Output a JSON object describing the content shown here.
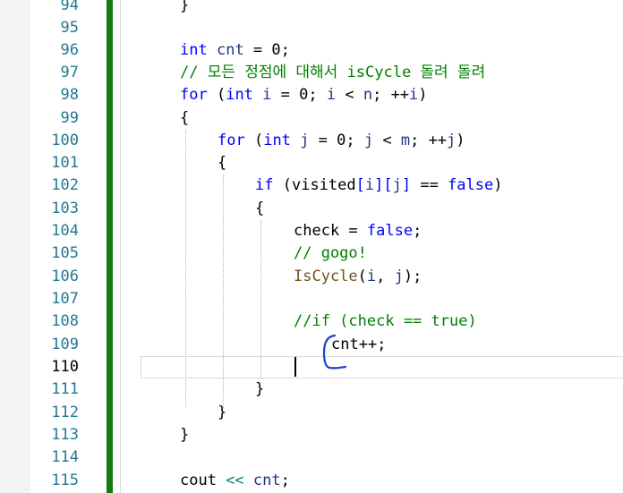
{
  "line_numbers": [
    "94",
    "95",
    "96",
    "97",
    "98",
    "99",
    "100",
    "101",
    "102",
    "103",
    "104",
    "105",
    "106",
    "107",
    "108",
    "109",
    "110",
    "111",
    "112",
    "113",
    "114",
    "115"
  ],
  "current_line": "110",
  "code": {
    "l94_brace": "}",
    "l96_int": "int",
    "l96_cnt": "cnt",
    "l96_eq": " = ",
    "l96_zero": "0",
    "l96_semi": ";",
    "l97_comment": "// 모든 정점에 대해서 isCycle 돌려 돌려",
    "l98_for": "for",
    "l98_open": " (",
    "l98_int": "int",
    "l98_i1": " i",
    "l98_eq": " = ",
    "l98_zero": "0",
    "l98_semi1": "; ",
    "l98_i2": "i",
    "l98_lt": " < ",
    "l98_n": "n",
    "l98_semi2": "; ",
    "l98_inc": "++",
    "l98_i3": "i",
    "l98_close": ")",
    "l99_brace": "{",
    "l100_for": "for",
    "l100_open": " (",
    "l100_int": "int",
    "l100_j1": " j",
    "l100_eq": " = ",
    "l100_zero": "0",
    "l100_semi1": "; ",
    "l100_j2": "j",
    "l100_lt": " < ",
    "l100_m": "m",
    "l100_semi2": "; ",
    "l100_inc": "++",
    "l100_j3": "j",
    "l100_close": ")",
    "l101_brace": "{",
    "l102_if": "if",
    "l102_open": " (",
    "l102_visited": "visited",
    "l102_b1": "[",
    "l102_i": "i",
    "l102_b2": "][",
    "l102_j": "j",
    "l102_b3": "]",
    "l102_eqeq": " == ",
    "l102_false": "false",
    "l102_close": ")",
    "l103_brace": "{",
    "l104_check": "check",
    "l104_eq": " = ",
    "l104_false": "false",
    "l104_semi": ";",
    "l105_comment": "// gogo!",
    "l106_fn": "IsCycle",
    "l106_open": "(",
    "l106_i": "i",
    "l106_comma": ", ",
    "l106_j": "j",
    "l106_close": ");",
    "l108_comment": "//if (check == true)",
    "l109_cnt": "cnt",
    "l109_inc": "++;",
    "l111_brace": "}",
    "l112_brace": "}",
    "l113_brace": "}",
    "l115_cout": "cout",
    "l115_op": " << ",
    "l115_cnt": "cnt",
    "l115_semi": ";"
  },
  "colors": {
    "keyword": "#0000ff",
    "comment": "#008000",
    "function": "#74531f",
    "line_number": "#237893",
    "change_bar": "#107c10",
    "annotation": "#1f3fd6"
  },
  "icons": {
    "annotation": "hand-drawn-bracket-mark"
  }
}
